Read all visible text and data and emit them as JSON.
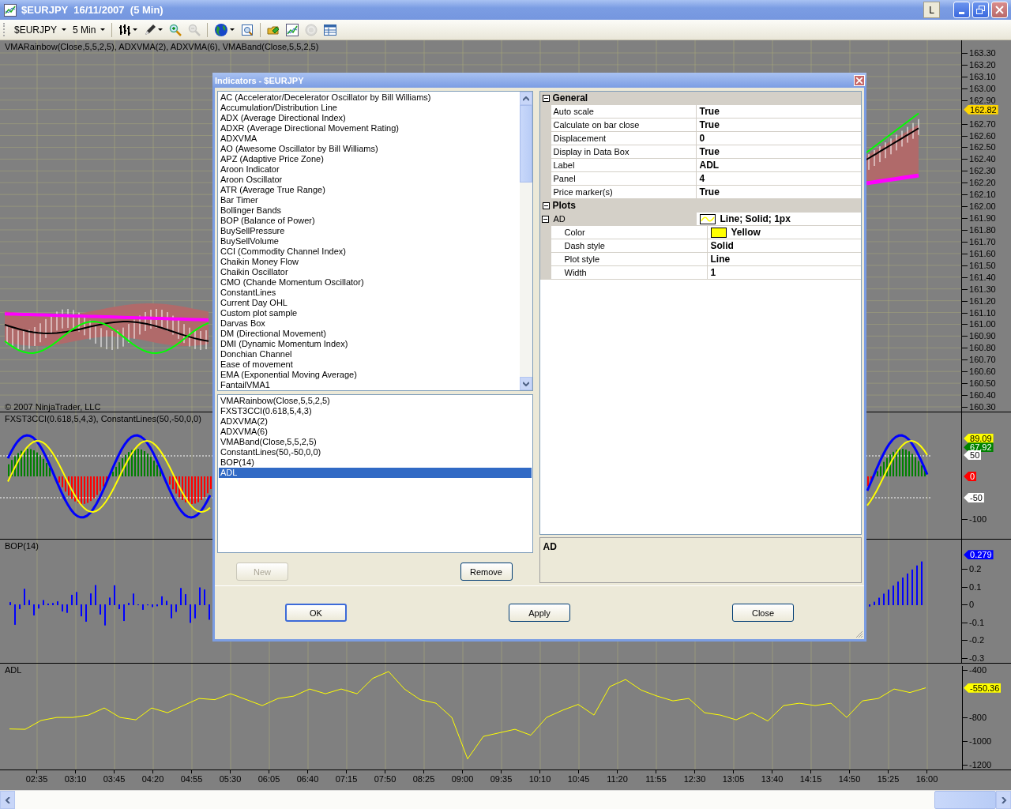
{
  "window": {
    "title": "$EURJPY  16/11/2007  (5 Min)",
    "controls": [
      {
        "kind": "layout",
        "label": "L"
      },
      {
        "kind": "minimize"
      },
      {
        "kind": "restore"
      },
      {
        "kind": "close"
      }
    ]
  },
  "toolbar": {
    "instrument": "$EURJPY",
    "period": "5 Min",
    "tools": [
      {
        "kind": "bars",
        "disabled": false,
        "dropdown": true
      },
      {
        "kind": "pencil",
        "disabled": false,
        "dropdown": true
      },
      {
        "kind": "zoom-in",
        "disabled": false,
        "dropdown": false
      },
      {
        "kind": "zoom-out",
        "disabled": true,
        "dropdown": false
      },
      {
        "kind": "globe",
        "disabled": false,
        "dropdown": true
      },
      {
        "kind": "preview",
        "disabled": false,
        "dropdown": false
      },
      {
        "kind": "folders",
        "disabled": false,
        "dropdown": false
      },
      {
        "kind": "chart",
        "disabled": false,
        "dropdown": false
      },
      {
        "kind": "coin",
        "disabled": true,
        "dropdown": false
      },
      {
        "kind": "table",
        "disabled": false,
        "dropdown": false
      }
    ]
  },
  "panels": [
    {
      "kind": "price",
      "legend": "VMARainbow(Close,5,5,2,5), ADXVMA(2), ADXVMA(6), VMABand(Close,5,5,2,5)",
      "note": "© 2007 NinjaTrader, LLC",
      "axis": [
        {
          "kind": "tick",
          "label": "163.30"
        },
        {
          "kind": "tick",
          "label": "163.20"
        },
        {
          "kind": "tick",
          "label": "163.10"
        },
        {
          "kind": "tick",
          "label": "163.00"
        },
        {
          "kind": "tick",
          "label": "162.90"
        },
        {
          "kind": "marker",
          "label": "162.82",
          "color": "#ffd700"
        },
        {
          "kind": "tick",
          "label": "162.70"
        },
        {
          "kind": "tick",
          "label": "162.60"
        },
        {
          "kind": "tick",
          "label": "162.50"
        },
        {
          "kind": "tick",
          "label": "162.40"
        },
        {
          "kind": "tick",
          "label": "162.30"
        },
        {
          "kind": "tick",
          "label": "162.20"
        },
        {
          "kind": "tick",
          "label": "162.10"
        },
        {
          "kind": "tick",
          "label": "162.00"
        },
        {
          "kind": "tick",
          "label": "161.90"
        },
        {
          "kind": "tick",
          "label": "161.80"
        },
        {
          "kind": "tick",
          "label": "161.70"
        },
        {
          "kind": "tick",
          "label": "161.60"
        },
        {
          "kind": "tick",
          "label": "161.50"
        },
        {
          "kind": "tick",
          "label": "161.40"
        },
        {
          "kind": "tick",
          "label": "161.30"
        },
        {
          "kind": "tick",
          "label": "161.20"
        },
        {
          "kind": "tick",
          "label": "161.10"
        },
        {
          "kind": "tick",
          "label": "161.00"
        },
        {
          "kind": "tick",
          "label": "160.90"
        },
        {
          "kind": "tick",
          "label": "160.80"
        },
        {
          "kind": "tick",
          "label": "160.70"
        },
        {
          "kind": "tick",
          "label": "160.60"
        },
        {
          "kind": "tick",
          "label": "160.50"
        },
        {
          "kind": "tick",
          "label": "160.40"
        },
        {
          "kind": "tick",
          "label": "160.30"
        }
      ]
    },
    {
      "kind": "oscillator",
      "legend": "FXST3CCI(0.618,5,4,3), ConstantLines(50,-50,0,0)",
      "axis": [
        {
          "kind": "marker",
          "label": "89.09",
          "color": "#ffff00"
        },
        {
          "kind": "marker",
          "label": "67.92",
          "color": "#008000"
        },
        {
          "kind": "marker",
          "label": "50",
          "color": "#ffffff"
        },
        {
          "kind": "marker",
          "label": "0",
          "color": "#ff0000"
        },
        {
          "kind": "marker",
          "label": "-50",
          "color": "#ffffff"
        },
        {
          "kind": "tick",
          "label": "-100"
        }
      ]
    },
    {
      "kind": "histogram",
      "legend": "BOP(14)",
      "axis": [
        {
          "kind": "marker",
          "label": "0.279",
          "color": "#0000ff"
        },
        {
          "kind": "tick",
          "label": "0.2"
        },
        {
          "kind": "tick",
          "label": "0.1"
        },
        {
          "kind": "tick",
          "label": "0"
        },
        {
          "kind": "tick",
          "label": "-0.1"
        },
        {
          "kind": "tick",
          "label": "-0.2"
        },
        {
          "kind": "tick",
          "label": "-0.3"
        }
      ]
    },
    {
      "kind": "line",
      "axis": [
        {
          "kind": "marker",
          "label": "-550.36",
          "color": "#ffff00"
        }
      ],
      "chart_data": {
        "type": "line",
        "series": [
          {
            "name": "ADL",
            "color": "#ffff00",
            "values": [
              -897,
              -900,
              -825,
              -800,
              -800,
              -780,
              -720,
              -800,
              -820,
              -720,
              -760,
              -700,
              -640,
              -650,
              -600,
              -650,
              -700,
              -640,
              -620,
              -560,
              -600,
              -560,
              -600,
              -470,
              -413,
              -560,
              -650,
              -680,
              -800,
              -1150,
              -960,
              -930,
              -900,
              -950,
              -800,
              -740,
              -690,
              -780,
              -540,
              -480,
              -570,
              -620,
              -660,
              -640,
              -760,
              -780,
              -820,
              -760,
              -830,
              -700,
              -680,
              -700,
              -680,
              -800,
              -660,
              -640,
              -560,
              -590,
              -550
            ]
          }
        ],
        "ylim": [
          -1246,
          -346
        ],
        "grid": true,
        "yticks": [
          {
            "value": -400,
            "label": "-400"
          },
          {
            "value": -800,
            "label": "-800"
          },
          {
            "value": -1000,
            "label": "-1000"
          },
          {
            "value": -1200,
            "label": "-1200"
          }
        ]
      }
    }
  ],
  "time_axis": [
    "02:35",
    "03:10",
    "03:45",
    "04:20",
    "04:55",
    "05:30",
    "06:05",
    "06:40",
    "07:15",
    "07:50",
    "08:25",
    "09:00",
    "09:35",
    "10:10",
    "10:45",
    "11:20",
    "11:55",
    "12:30",
    "13:05",
    "13:40",
    "14:15",
    "14:50",
    "15:25",
    "16:00"
  ],
  "dialog": {
    "title": "Indicators - $EURJPY",
    "available": [
      {
        "label": "AC (Accelerator/Decelerator Oscillator by Bill Williams)",
        "selected": false
      },
      {
        "label": "Accumulation/Distribution Line",
        "selected": false
      },
      {
        "label": "ADX (Average Directional Index)",
        "selected": false
      },
      {
        "label": "ADXR (Average Directional Movement Rating)",
        "selected": false
      },
      {
        "label": "ADXVMA",
        "selected": false
      },
      {
        "label": "AO (Awesome Oscillator by Bill Williams)",
        "selected": false
      },
      {
        "label": "APZ (Adaptive Price Zone)",
        "selected": false
      },
      {
        "label": "Aroon Indicator",
        "selected": false
      },
      {
        "label": "Aroon Oscillator",
        "selected": false
      },
      {
        "label": "ATR (Average True Range)",
        "selected": false
      },
      {
        "label": "Bar Timer",
        "selected": false
      },
      {
        "label": "Bollinger Bands",
        "selected": false
      },
      {
        "label": "BOP (Balance of Power)",
        "selected": false
      },
      {
        "label": "BuySellPressure",
        "selected": false
      },
      {
        "label": "BuySellVolume",
        "selected": false
      },
      {
        "label": "CCI (Commodity Channel Index)",
        "selected": false
      },
      {
        "label": "Chaikin Money Flow",
        "selected": false
      },
      {
        "label": "Chaikin Oscillator",
        "selected": false
      },
      {
        "label": "CMO (Chande Momentum Oscillator)",
        "selected": false
      },
      {
        "label": "ConstantLines",
        "selected": false
      },
      {
        "label": "Current Day OHL",
        "selected": false
      },
      {
        "label": "Custom plot sample",
        "selected": false
      },
      {
        "label": "Darvas Box",
        "selected": false
      },
      {
        "label": "DM (Directional Movement)",
        "selected": false
      },
      {
        "label": "DMI (Dynamic Momentum Index)",
        "selected": false
      },
      {
        "label": "Donchian Channel",
        "selected": false
      },
      {
        "label": "Ease of movement",
        "selected": false
      },
      {
        "label": "EMA (Exponential Moving Average)",
        "selected": false
      },
      {
        "label": "FantailVMA1",
        "selected": false
      }
    ],
    "applied": [
      {
        "label": "VMARainbow(Close,5,5,2,5)",
        "selected": false
      },
      {
        "label": "FXST3CCI(0.618,5,4,3)",
        "selected": false
      },
      {
        "label": "ADXVMA(2)",
        "selected": false
      },
      {
        "label": "ADXVMA(6)",
        "selected": false
      },
      {
        "label": "VMABand(Close,5,5,2,5)",
        "selected": false
      },
      {
        "label": "ConstantLines(50,-50,0,0)",
        "selected": false
      },
      {
        "label": "BOP(14)",
        "selected": false
      },
      {
        "label": "ADL",
        "selected": true
      }
    ],
    "list_buttons": [
      {
        "label": "New",
        "disabled": true
      },
      {
        "label": "Remove",
        "disabled": false
      }
    ],
    "properties": [
      {
        "name": "General",
        "expanded": true,
        "rows": [
          {
            "name": "Auto scale",
            "value": "True"
          },
          {
            "name": "Calculate on bar close",
            "value": "True"
          },
          {
            "name": "Displacement",
            "value": "0"
          },
          {
            "name": "Display in Data Box",
            "value": "True"
          },
          {
            "name": "Label",
            "value": "ADL"
          },
          {
            "name": "Panel",
            "value": "4"
          },
          {
            "name": "Price marker(s)",
            "value": "True"
          }
        ]
      },
      {
        "name": "Plots",
        "expanded": true,
        "rows": [
          {
            "name": "AD",
            "value": "Line; Solid; 1px",
            "kind": "plot",
            "color": "#ffff00",
            "expanded": true,
            "children": [
              {
                "name": "Color",
                "value": "Yellow",
                "kind": "color",
                "color": "#ffff00"
              },
              {
                "name": "Dash style",
                "value": "Solid"
              },
              {
                "name": "Plot style",
                "value": "Line"
              },
              {
                "name": "Width",
                "value": "1"
              }
            ]
          }
        ]
      }
    ],
    "description": "AD",
    "buttons": [
      {
        "label": "OK",
        "default": true
      },
      {
        "label": "Apply",
        "default": false
      },
      {
        "label": "Close",
        "default": false
      }
    ]
  }
}
